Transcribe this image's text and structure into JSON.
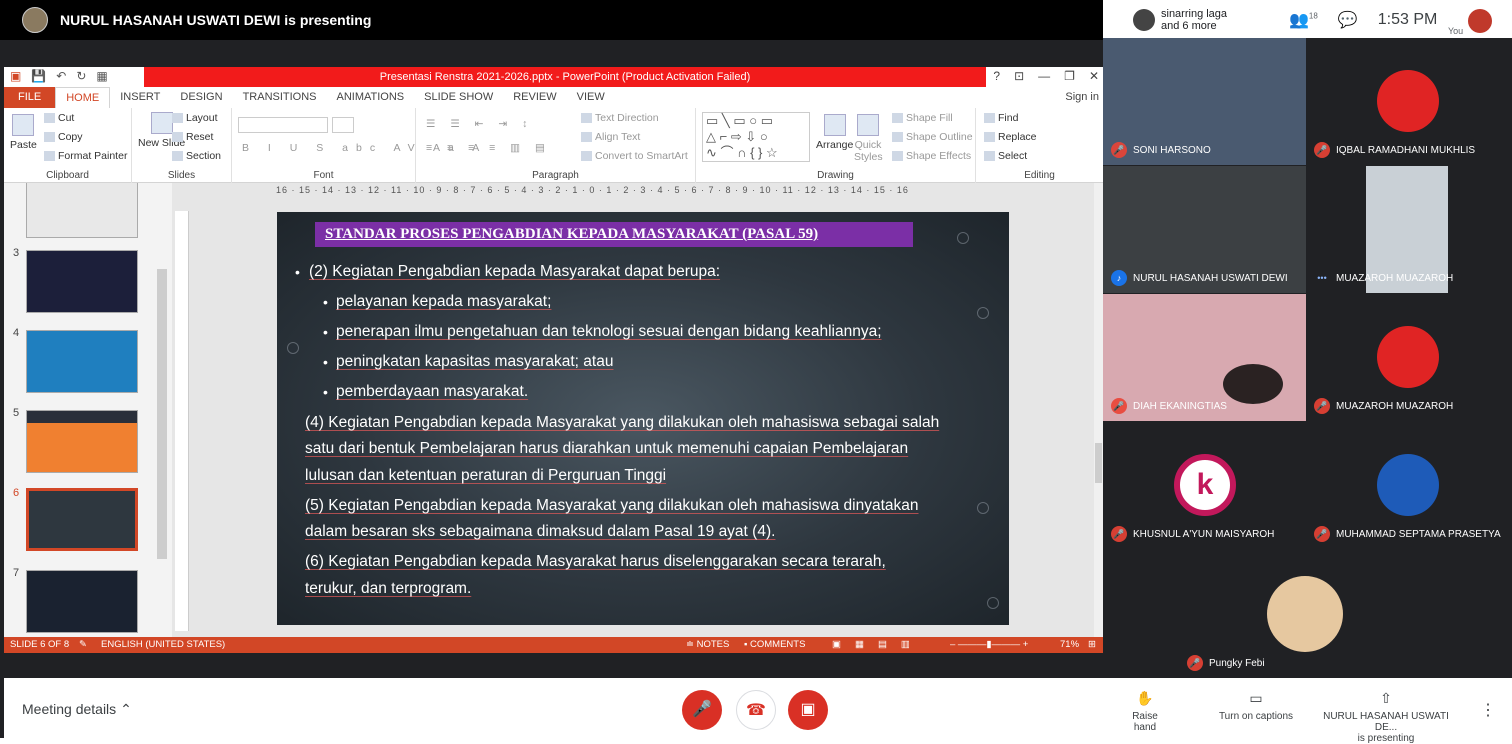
{
  "meet": {
    "presenting_banner": "NURUL HASANAH USWATI DEWI is presenting",
    "participants_summary_line1": "sinarring laga",
    "participants_summary_line2": "and 6 more",
    "people_count": "18",
    "time": "1:53 PM",
    "you_label": "You",
    "meeting_details": "Meeting details",
    "raise_hand": "Raise hand",
    "captions": "Turn on captions",
    "presenting_name": "NURUL HASANAH USWATI DE...",
    "presenting_sub": "is presenting",
    "tiles": [
      {
        "name": "SONI HARSONO",
        "bg": "#4a5a70"
      },
      {
        "name": "IQBAL RAMADHANI MUKHLIS",
        "bg": "#202124"
      },
      {
        "name": "NURUL HASANAH USWATI DEWI",
        "bg": "#6b5a45"
      },
      {
        "name": "MUAZAROH MUAZAROH",
        "bg": "#202124"
      },
      {
        "name": "DIAH EKANINGTIAS",
        "bg": "#d8a9b0"
      },
      {
        "name": "MUAZAROH MUAZAROH",
        "bg": "#202124"
      },
      {
        "name": "KHUSNUL A'YUN MAISYAROH",
        "bg": "#202124"
      },
      {
        "name": "MUHAMMAD SEPTAMA PRASETYA",
        "bg": "#202124"
      },
      {
        "name": "Pungky Febi",
        "bg": "#202124"
      }
    ],
    "colors": {
      "end_call": "#ea4335",
      "mic_off": "#d93025"
    }
  },
  "ppt": {
    "window_title": "Presentasi Renstra 2021-2026.pptx -  PowerPoint (Product Activation Failed)",
    "tabs": [
      "FILE",
      "HOME",
      "INSERT",
      "DESIGN",
      "TRANSITIONS",
      "ANIMATIONS",
      "SLIDE SHOW",
      "REVIEW",
      "VIEW"
    ],
    "sign_in": "Sign in",
    "ribbon": {
      "paste": "Paste",
      "cut": "Cut",
      "copy": "Copy",
      "format_painter": "Format Painter",
      "clipboard": "Clipboard",
      "new_slide": "New Slide",
      "layout": "Layout",
      "reset": "Reset",
      "section": "Section",
      "slides": "Slides",
      "font": "Font",
      "text_direction": "Text Direction",
      "align_text": "Align Text",
      "convert_smartart": "Convert to SmartArt",
      "paragraph": "Paragraph",
      "arrange": "Arrange",
      "quick_styles": "Quick Styles",
      "shape_fill": "Shape Fill",
      "shape_outline": "Shape Outline",
      "shape_effects": "Shape Effects",
      "drawing": "Drawing",
      "find": "Find",
      "replace": "Replace",
      "select": "Select",
      "editing": "Editing"
    },
    "ruler": "16 · 15 · 14 · 13 · 12 · 11 · 10 · 9 · 8 · 7 · 6 · 5 · 4 · 3 · 2 · 1 · 0 · 1 · 2 · 3 · 4 · 5 · 6 · 7 · 8 · 9 · 10 · 11 · 12 · 13 · 14 · 15 · 16",
    "thumb_numbers": [
      "3",
      "4",
      "5",
      "6",
      "7"
    ],
    "slide": {
      "title": "STANDAR PROSES PENGABDIAN KEPADA MASYARAKAT (PASAL 59)",
      "point2": "(2) Kegiatan Pengabdian kepada Masyarakat dapat berupa:",
      "sub1": "pelayanan kepada masyarakat;",
      "sub2": "penerapan ilmu pengetahuan dan teknologi sesuai dengan bidang keahliannya;",
      "sub3": "peningkatan kapasitas masyarakat; atau",
      "sub4": "pemberdayaan masyarakat.",
      "p4_l1": "(4) Kegiatan Pengabdian kepada Masyarakat yang dilakukan oleh mahasiswa sebagai salah",
      "p4_l2": "satu dari bentuk Pembelajaran harus diarahkan untuk memenuhi capaian Pembelajaran",
      "p4_l3": "lulusan dan ketentuan peraturan di Perguruan Tinggi",
      "p5_l1": "(5) Kegiatan Pengabdian kepada Masyarakat yang dilakukan oleh mahasiswa dinyatakan",
      "p5_l2": "dalam besaran sks sebagaimana dimaksud dalam Pasal 19 ayat (4).",
      "p6_l1": "(6) Kegiatan Pengabdian kepada Masyarakat harus diselenggarakan secara terarah,",
      "p6_l2": "terukur, dan terprogram."
    },
    "status": {
      "slide_of": "SLIDE 6 OF 8",
      "language": "ENGLISH (UNITED STATES)",
      "notes": "NOTES",
      "comments": "COMMENTS",
      "zoom": "71%"
    }
  }
}
